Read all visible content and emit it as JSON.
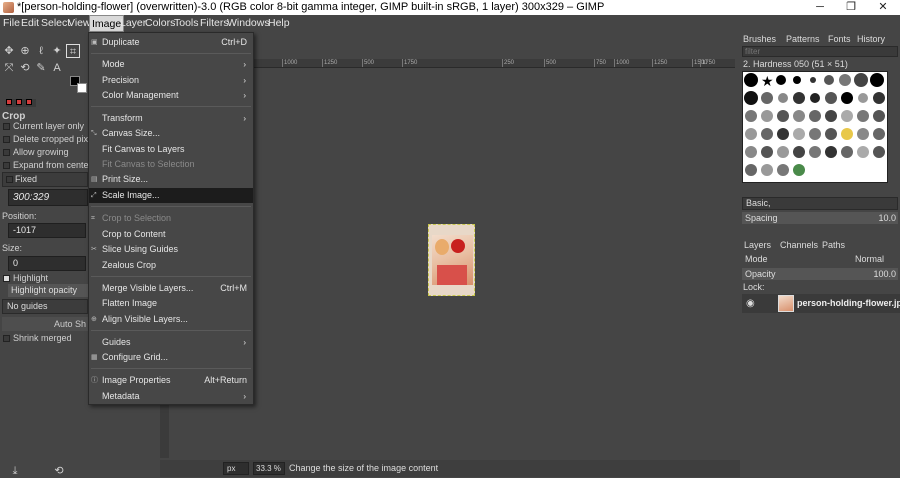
{
  "window": {
    "title": "*[person-holding-flower] (overwritten)-3.0 (RGB color 8-bit gamma integer, GIMP built-in sRGB, 1 layer) 300x329 – GIMP",
    "minimize": "─",
    "maximize": "❐",
    "close": "✕"
  },
  "menubar": [
    "File",
    "Edit",
    "Select",
    "View",
    "Image",
    "Layer",
    "Colors",
    "Tools",
    "Filters",
    "Windows",
    "Help"
  ],
  "image_menu": {
    "items": [
      {
        "label": "Duplicate",
        "shortcut": "Ctrl+D"
      },
      {
        "label": "Mode",
        "arrow": "›"
      },
      {
        "label": "Precision",
        "arrow": "›"
      },
      {
        "label": "Color Management",
        "arrow": "›"
      },
      {
        "label": "Transform",
        "arrow": "›"
      },
      {
        "label": "Canvas Size..."
      },
      {
        "label": "Fit Canvas to Layers"
      },
      {
        "label": "Fit Canvas to Selection"
      },
      {
        "label": "Print Size..."
      },
      {
        "label": "Scale Image..."
      },
      {
        "label": "Crop to Selection"
      },
      {
        "label": "Crop to Content"
      },
      {
        "label": "Slice Using Guides"
      },
      {
        "label": "Zealous Crop"
      },
      {
        "label": "Merge Visible Layers...",
        "shortcut": "Ctrl+M"
      },
      {
        "label": "Flatten Image"
      },
      {
        "label": "Align Visible Layers..."
      },
      {
        "label": "Guides",
        "arrow": "›"
      },
      {
        "label": "Configure Grid..."
      },
      {
        "label": "Image Properties",
        "shortcut": "Alt+Return"
      },
      {
        "label": "Metadata",
        "arrow": "›"
      }
    ]
  },
  "tool_options": {
    "title": "Crop",
    "current_layer_only": "Current layer only",
    "delete_cropped": "Delete cropped pixels",
    "allow_growing": "Allow growing",
    "expand_from_center": "Expand from center",
    "fixed": "Fixed",
    "ratio": "300:329",
    "position_label": "Position:",
    "position_value": "-1017",
    "size_label": "Size:",
    "size_value": "0",
    "highlight": "Highlight",
    "highlight_opacity": "Highlight opacity",
    "guides": "No guides",
    "auto_shrink": "Auto Sh",
    "shrink_merged": "Shrink merged"
  },
  "ruler_ticks": [
    "1000",
    "1250",
    "500",
    "1750",
    "250",
    "500",
    "750",
    "1000",
    "1250",
    "1500",
    "1750"
  ],
  "statusbar": {
    "unit": "px",
    "zoom": "33.3 %",
    "message": "Change the size of the image content"
  },
  "right_dock": {
    "tabs": [
      "Brushes",
      "Patterns",
      "Fonts",
      "History"
    ],
    "filter_placeholder": "filter",
    "brush_name": "2. Hardness 050 (51 × 51)",
    "preset": "Basic,",
    "spacing_label": "Spacing",
    "spacing_value": "10.0",
    "layer_tabs": [
      "Layers",
      "Channels",
      "Paths"
    ],
    "mode_label": "Mode",
    "mode_value": "Normal",
    "opacity_label": "Opacity",
    "opacity_value": "100.0",
    "lock_label": "Lock:",
    "layer_name": "person-holding-flower.jpg"
  }
}
